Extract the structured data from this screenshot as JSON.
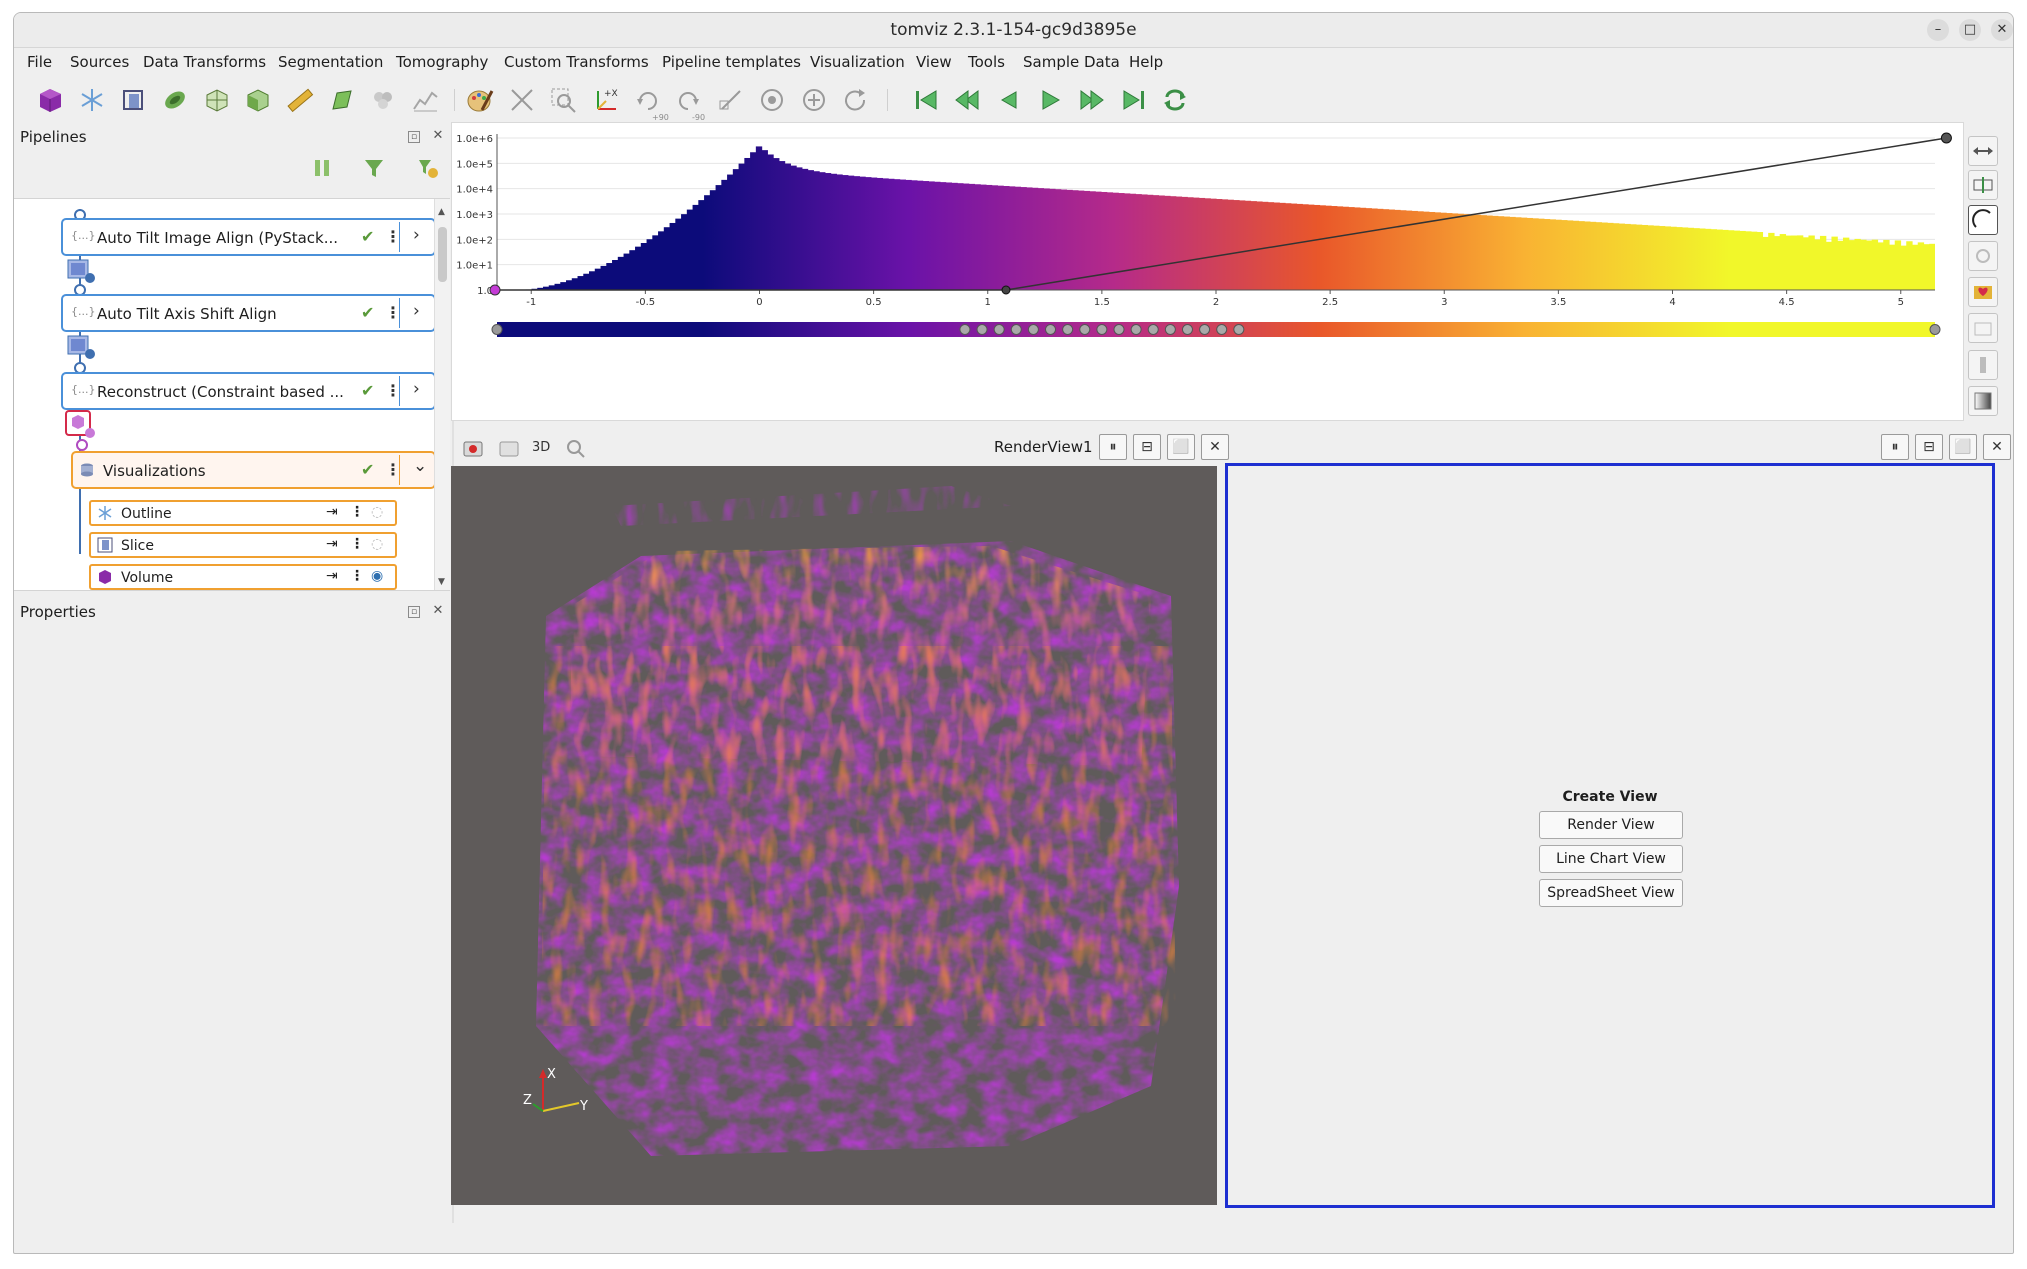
{
  "window": {
    "title": "tomviz 2.3.1-154-gc9d3895e",
    "controls": [
      "–",
      "□",
      "✕"
    ]
  },
  "menu": [
    "File",
    "Sources",
    "Data Transforms",
    "Segmentation",
    "Tomography",
    "Custom Transforms",
    "Pipeline templates",
    "Visualization",
    "View",
    "Tools",
    "Sample Data",
    "Help"
  ],
  "toolbar": {
    "rotate_labels": [
      "+90",
      "-90"
    ]
  },
  "pipelines": {
    "title": "Pipelines",
    "nodes": [
      {
        "label": "Auto Tilt Image Align (PyStack...",
        "check": "✔",
        "more": "⋮",
        "arrow": "›"
      },
      {
        "label": "Auto Tilt Axis Shift Align",
        "check": "✔",
        "more": "⋮",
        "arrow": "›"
      },
      {
        "label": "Reconstruct (Constraint based ...",
        "check": "✔",
        "more": "⋮",
        "arrow": "›"
      }
    ],
    "node_glyph": "{...}",
    "visualizations": {
      "label": "Visualizations",
      "check": "✔",
      "more": "⋮",
      "arrow": "⌄",
      "items": [
        {
          "label": "Outline",
          "icon": "outline-icon",
          "visible": false
        },
        {
          "label": "Slice",
          "icon": "slice-icon",
          "visible": false
        },
        {
          "label": "Volume",
          "icon": "volume-icon",
          "visible": true
        }
      ]
    }
  },
  "properties": {
    "title": "Properties"
  },
  "chart_data": {
    "type": "bar",
    "title": "",
    "xlabel": "",
    "ylabel": "",
    "y_scale": "log",
    "ylim": [
      1,
      1000000
    ],
    "y_tick_labels": [
      "1.0e+6",
      "1.0e+5",
      "1.0e+4",
      "1.0e+3",
      "1.0e+2",
      "1.0e+1",
      "1.0"
    ],
    "xlim": [
      -1.15,
      5.15
    ],
    "x_tick_values": [
      -1,
      -0.5,
      0,
      0.5,
      1,
      1.5,
      2,
      2.5,
      3,
      3.5,
      4,
      4.5,
      5
    ],
    "x_tick_labels": [
      "-1",
      "-0.5",
      "0",
      "0.5",
      "1",
      "1.5",
      "2",
      "2.5",
      "3",
      "3.5",
      "4",
      "4.5",
      "5"
    ],
    "histogram_peak_x": 0,
    "histogram_peak_count": 500000,
    "opacity_line": {
      "x": [
        1.08,
        5.2
      ],
      "opacity": [
        0,
        1
      ]
    },
    "colormap": [
      "#0c0b7a",
      "#0c0b7a",
      "#6a12a8",
      "#b52a8a",
      "#e9572a",
      "#f9b233",
      "#f1f72a",
      "#f1f72a"
    ]
  },
  "render_view": {
    "title": "RenderView1",
    "mode_label": "3D",
    "axes": {
      "x": "X",
      "y": "Y",
      "z": "Z"
    }
  },
  "view_buttons": [
    "⏸",
    "⊟",
    "⬜",
    "✕"
  ],
  "create_view": {
    "title": "Create View",
    "buttons": [
      "Render View",
      "Line Chart View",
      "SpreadSheet View"
    ]
  }
}
